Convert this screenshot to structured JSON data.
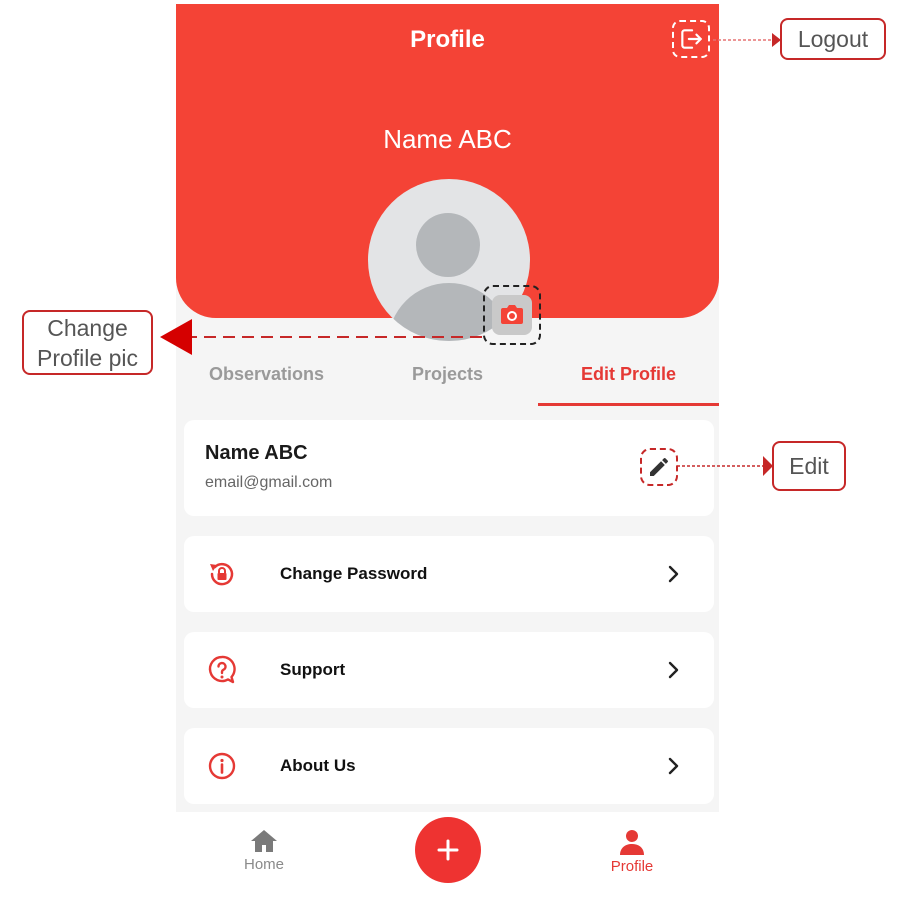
{
  "header": {
    "title": "Profile",
    "user_name": "Name ABC",
    "accent_color": "#f44336"
  },
  "icons": {
    "logout": "logout-icon",
    "camera": "camera-icon",
    "edit": "pencil-icon",
    "change_password": "lock-reset-icon",
    "support": "question-icon",
    "about": "info-icon",
    "chevron": "chevron-right-icon",
    "home": "home-icon",
    "profile": "person-icon",
    "add": "plus-icon"
  },
  "tabs": [
    {
      "label": "Observations",
      "active": false
    },
    {
      "label": "Projects",
      "active": false
    },
    {
      "label": "Edit Profile",
      "active": true
    }
  ],
  "profile_card": {
    "name": "Name ABC",
    "email": "email@gmail.com"
  },
  "menu": [
    {
      "label": "Change Password"
    },
    {
      "label": "Support"
    },
    {
      "label": "About Us"
    }
  ],
  "bottom_nav": {
    "home_label": "Home",
    "profile_label": "Profile"
  },
  "annotations": {
    "logout": "Logout",
    "edit": "Edit",
    "change_pic_line1": "Change",
    "change_pic_line2": "Profile pic"
  }
}
